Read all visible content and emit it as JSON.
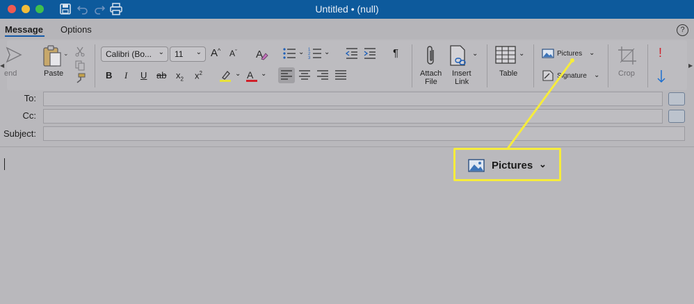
{
  "window": {
    "title": "Untitled • (null)"
  },
  "tabs": [
    {
      "label": "Message",
      "active": true
    },
    {
      "label": "Options",
      "active": false
    }
  ],
  "help_label": "?",
  "ribbon": {
    "send_label": "end",
    "paste_label": "Paste",
    "font_name": "Calibri (Bo...",
    "font_size": "11",
    "bold": "B",
    "italic": "I",
    "underline": "U",
    "strikethrough": "ab",
    "subscript": "x",
    "superscript": "x",
    "grow_font": "A",
    "shrink_font": "A",
    "paragraph": "¶",
    "attach_file": [
      "Attach",
      "File"
    ],
    "insert_link": [
      "Insert",
      "Link"
    ],
    "table_label": "Table",
    "pictures_label": "Pictures",
    "signature_label": "Signature",
    "crop_label": "Crop",
    "importance_mark": "!"
  },
  "header": {
    "to_label": "To:",
    "cc_label": "Cc:",
    "subject_label": "Subject:",
    "to_value": "",
    "cc_value": "",
    "subject_value": ""
  },
  "callout": {
    "label": "Pictures"
  },
  "colors": {
    "titlebar": "#0d5a9c",
    "highlight": "#f6ec3c",
    "font_color": "#d0202a",
    "importance": "#d0202a",
    "low_importance": "#1d6fd0"
  }
}
